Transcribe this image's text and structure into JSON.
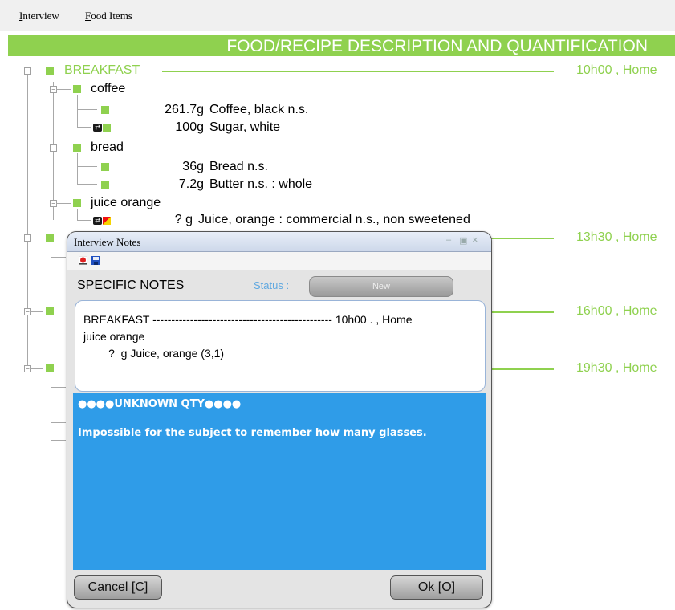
{
  "menu": {
    "interview_underline": "I",
    "interview_rest": "nterview",
    "fooditems_underline": "F",
    "fooditems_rest": "ood Items"
  },
  "header": {
    "title": "FOOD/RECIPE DESCRIPTION AND QUANTIFICATION"
  },
  "meals": [
    {
      "label": "BREAKFAST",
      "time": "10h00 , Home"
    },
    {
      "label": "",
      "time": "13h30 , Home"
    },
    {
      "label": "",
      "time": "16h00 , Home"
    },
    {
      "label": "",
      "time": "19h30 , Home"
    }
  ],
  "items": {
    "coffee": {
      "label": "coffee",
      "foods": [
        {
          "qty": "261.7g",
          "name": "Coffee, black n.s."
        },
        {
          "qty": "100g",
          "name": "Sugar, white"
        }
      ]
    },
    "bread": {
      "label": "bread",
      "foods": [
        {
          "qty": "36g",
          "name": "Bread n.s."
        },
        {
          "qty": "7.2g",
          "name": "Butter n.s. : whole"
        }
      ]
    },
    "juice": {
      "label": "juice orange",
      "foods": [
        {
          "qty": "?  g",
          "name": "Juice, orange : commercial n.s., non sweetened"
        }
      ]
    }
  },
  "dialog": {
    "title": "Interview Notes",
    "window_buttons": {
      "minimize": "–",
      "restore": "▣",
      "close": "×"
    },
    "notes_header": "SPECIFIC NOTES",
    "status_label": "Status :",
    "status_value": "New",
    "notes": {
      "line1": "BREAKFAST ------------------------------------------------ 10h00 . , Home",
      "line2": "juice orange",
      "line3": "        ?  g Juice, orange (3,1)"
    },
    "comment_title": "●●●●UNKNOWN QTY●●●●",
    "comment_body": "Impossible for the subject to remember how many glasses.",
    "cancel_label": "Cancel [C]",
    "ok_label": "Ok [O]"
  },
  "colors": {
    "accent_green": "#8fd14f",
    "notes_blue": "#2f9ce8"
  },
  "icons": [
    "record-icon",
    "save-icon",
    "food-link-icon",
    "unknown-qty-icon"
  ]
}
